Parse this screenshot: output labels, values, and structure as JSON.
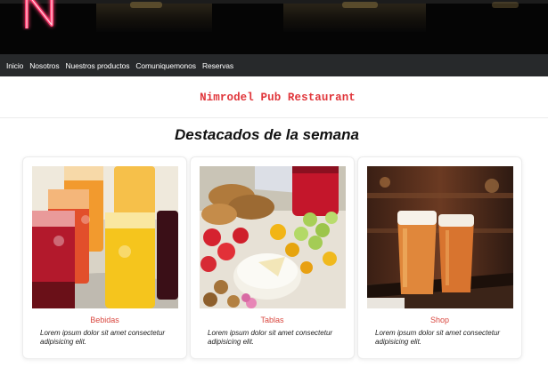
{
  "nav": {
    "items": [
      "Inicio",
      "Nosotros",
      "Nuestros productos",
      "Comuniquemonos",
      "Reservas"
    ]
  },
  "header": {
    "logo_letter": "N",
    "brand": "Nimrodel Pub Restaurant"
  },
  "section": {
    "title": "Destacados de la semana"
  },
  "cards": [
    {
      "title": "Bebidas",
      "text": "Lorem ipsum dolor sit amet consectetur adipisicing elit.",
      "image": "colorful-cocktails-photo"
    },
    {
      "title": "Tablas",
      "text": "Lorem ipsum dolor sit amet consectetur adipisicing elit.",
      "image": "charcuterie-board-photo"
    },
    {
      "title": "Shop",
      "text": "Lorem ipsum dolor sit amet consectetur adipisicing elit.",
      "image": "beer-glasses-bar-photo"
    }
  ],
  "colors": {
    "brand_red": "#e0353a",
    "card_title": "#d9473f",
    "nav_bg": "#27292b",
    "hero_bg": "#050505"
  }
}
